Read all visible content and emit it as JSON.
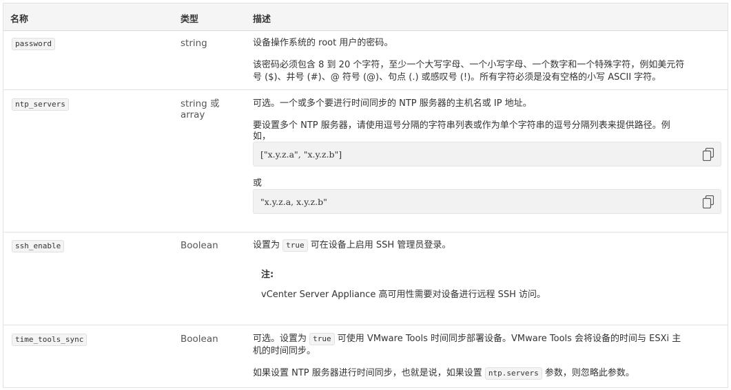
{
  "headers": {
    "name": "名称",
    "type": "类型",
    "desc": "描述"
  },
  "rows": {
    "password": {
      "name": "password",
      "type": "string",
      "p1": "设备操作系统的 root 用户的密码。",
      "p2a": "该密码必须包含 8 到 20 个字符，至少一个大写字母、一个小写字母、一个数字和一个特殊字符，例如美元符",
      "p2b": "号 ($)、井号 (#)、@ 符号 (@)、句点 (.) 或感叹号 (!)。所有字符必须是没有空格的小写 ASCII 字符。"
    },
    "ntp": {
      "name": "ntp_servers",
      "type_a": "string 或",
      "type_b": "array",
      "p1": "可选。一个或多个要进行时间同步的 NTP 服务器的主机名或 IP 地址。",
      "p2a": "要设置多个 NTP 服务器，请使用逗号分隔的字符串列表或作为单个字符串的逗号分隔列表来提供路径。例",
      "p2b": "如，",
      "code1": "[\"x.y.z.a\", \"x.y.z.b\"]",
      "or": "或",
      "code2": "\"x.y.z.a, x.y.z.b\""
    },
    "ssh": {
      "name": "ssh_enable",
      "type": "Boolean",
      "pre": "设置为",
      "code": "true",
      "post": "可在设备上启用 SSH 管理员登录。",
      "note_title": "注:",
      "note_text": "vCenter Server Appliance 高可用性需要对设备进行远程 SSH 访问。"
    },
    "tools": {
      "name": "time_tools_sync",
      "type": "Boolean",
      "l1_pre": "可选。设置为",
      "l1_code": "true",
      "l1_post": "可使用 VMware Tools 时间同步部署设备。VMware Tools 会将设备的时间与 ESXi 主",
      "l2": "机的时间同步。",
      "l3_pre": "如果设置 NTP 服务器进行时间同步，也就是说，如果设置",
      "l3_code": "ntp.servers",
      "l3_post": "参数，则忽略此参数。"
    }
  }
}
